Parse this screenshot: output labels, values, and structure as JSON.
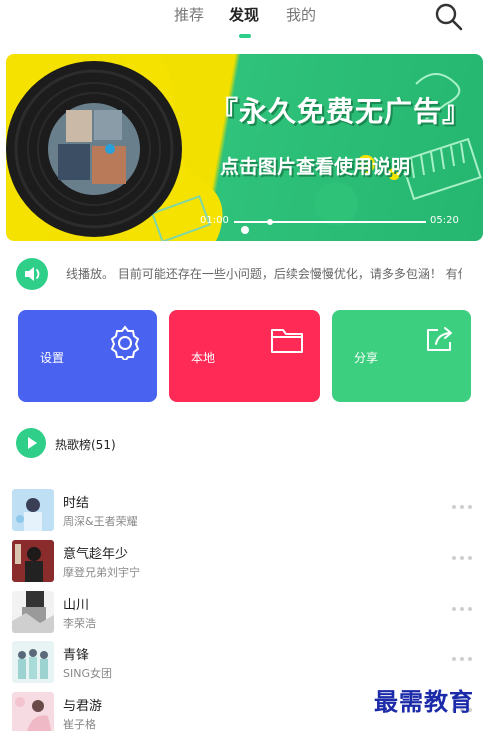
{
  "nav": {
    "tabs": [
      {
        "label": "推荐"
      },
      {
        "label": "发现"
      },
      {
        "label": "我的"
      }
    ],
    "active_index": 1
  },
  "banner": {
    "title": "『永久免费无广告』",
    "subtitle": "点击图片查看使用说明",
    "time_start": "01:00",
    "time_end": "05:20"
  },
  "announcement": {
    "text": "线播放。 目前可能还存在一些小问题，后续会慢慢优化，请多多包涵！ 有什"
  },
  "tiles": [
    {
      "label": "设置",
      "icon": "gear-icon",
      "color": "#4a62f0"
    },
    {
      "label": "本地",
      "icon": "folder-icon",
      "color": "#ff2a55"
    },
    {
      "label": "分享",
      "icon": "share-icon",
      "color": "#3ccf7f"
    }
  ],
  "hot_list": {
    "title": "热歌榜(51)"
  },
  "songs": [
    {
      "title": "时结",
      "artist": "周深&王者荣耀"
    },
    {
      "title": "意气趁年少",
      "artist": "摩登兄弟刘宇宁"
    },
    {
      "title": "山川",
      "artist": "李荣浩"
    },
    {
      "title": "青锋",
      "artist": "SING女团"
    },
    {
      "title": "与君游",
      "artist": "崔子格"
    }
  ],
  "watermark": "最需教育",
  "colors": {
    "accent": "#2fcf8a",
    "text_primary": "#222222",
    "text_secondary": "#888888"
  }
}
